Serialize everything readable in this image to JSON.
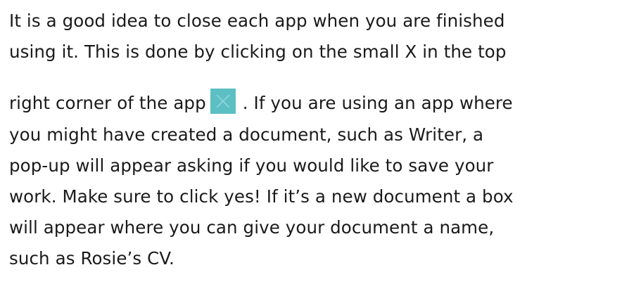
{
  "paragraph": {
    "line1": "It is a good idea to close each app when you are finished",
    "line2": "using it.  This is done by clicking on the small X in the top",
    "line3_before_icon": "right corner of the app",
    "line3_after_icon": ".  If you are using an app where",
    "line4": "you might have created a document, such as Writer, a",
    "line5": "pop-up will appear asking if you would like to save your",
    "line6": "work.   Make sure to click yes! If it’s a new document a box",
    "line7": "will appear where you can give your document a name,",
    "line8": "such as Rosie’s CV."
  },
  "icon": {
    "name": "close-x-icon",
    "background": "#5cbfc4",
    "stroke": "#8fd6da"
  }
}
